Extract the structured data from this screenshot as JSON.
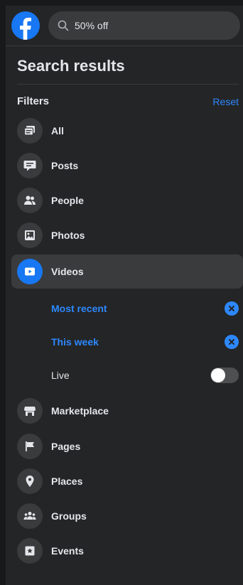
{
  "search": {
    "value": "50% off"
  },
  "header": {
    "title": "Search results"
  },
  "filters": {
    "label": "Filters",
    "reset_label": "Reset"
  },
  "nav": {
    "all": "All",
    "posts": "Posts",
    "people": "People",
    "photos": "Photos",
    "videos": "Videos",
    "marketplace": "Marketplace",
    "pages": "Pages",
    "places": "Places",
    "groups": "Groups",
    "events": "Events"
  },
  "video_filters": {
    "most_recent": "Most recent",
    "this_week": "This week",
    "live": "Live",
    "live_enabled": false
  },
  "colors": {
    "accent": "#2d88ff",
    "brand": "#1877f2",
    "background": "#242526"
  }
}
